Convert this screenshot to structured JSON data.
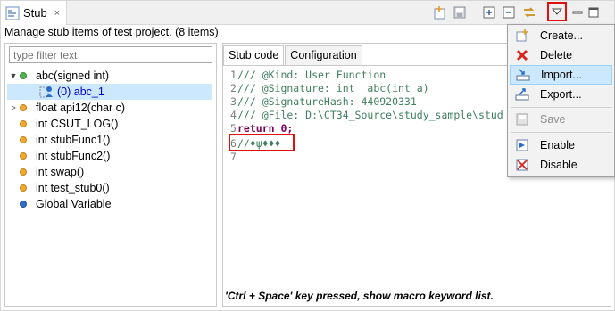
{
  "view": {
    "tab_title": "Stub",
    "close_glyph": "×",
    "description": "Manage stub items of test project. (8 items)"
  },
  "toolbar": {
    "icons": [
      "new-stub-icon",
      "save-icon",
      "expand-all-icon",
      "collapse-all-icon",
      "sync-icon",
      "view-menu-icon",
      "minimize-icon",
      "maximize-icon"
    ]
  },
  "filter": {
    "placeholder": "type filter text"
  },
  "tree": {
    "root_label": "abc(signed int)",
    "child_label": "(0) abc_1",
    "items": [
      "float  api12(char c)",
      "int  CSUT_LOG()",
      "int  stubFunc1()",
      "int  stubFunc2()",
      "int  swap()",
      "int  test_stub0()",
      "Global Variable"
    ]
  },
  "editor": {
    "tabs": [
      "Stub code",
      "Configuration"
    ],
    "lines": [
      {
        "num": "1",
        "text": "/// @Kind: User Function",
        "kind": "comment"
      },
      {
        "num": "2",
        "text": "/// @Signature: int  abc(int a)",
        "kind": "comment"
      },
      {
        "num": "3",
        "text": "/// @SignatureHash: 440920331",
        "kind": "comment"
      },
      {
        "num": "4",
        "text": "/// @File: D:\\CT34_Source\\study_sample\\stud",
        "kind": "comment"
      },
      {
        "num": "5",
        "text": "return 0;",
        "kind": "code"
      },
      {
        "num": "6",
        "text": "//♦ψ♦♦♦",
        "kind": "comment"
      },
      {
        "num": "7",
        "text": "",
        "kind": "code"
      }
    ],
    "status": "'Ctrl + Space' key pressed, show macro keyword list."
  },
  "menu": {
    "items": [
      {
        "label": "Create...",
        "icon": "create-icon"
      },
      {
        "label": "Delete",
        "icon": "delete-icon"
      },
      {
        "label": "Import...",
        "icon": "import-icon"
      },
      {
        "label": "Export...",
        "icon": "export-icon"
      },
      {
        "label": "Save",
        "icon": "save-icon"
      },
      {
        "label": "Enable",
        "icon": "enable-icon"
      },
      {
        "label": "Disable",
        "icon": "disable-icon"
      }
    ]
  },
  "colors": {
    "selection": "#cce8ff",
    "highlight_border": "#e01010",
    "comment": "#3f7f5f",
    "keyword": "#7f0055"
  }
}
